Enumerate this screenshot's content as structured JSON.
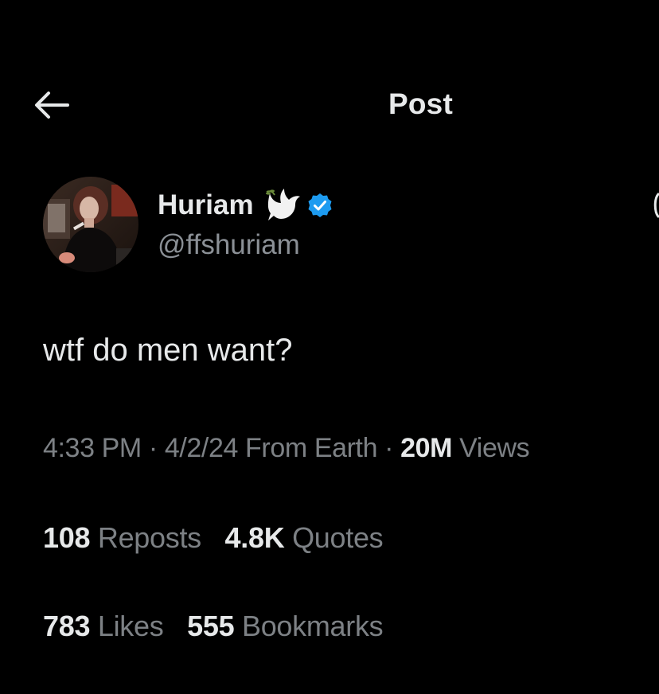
{
  "header": {
    "back_icon": "arrow-left-icon",
    "title": "Post"
  },
  "author": {
    "name": "Huriam",
    "name_emoji_icon": "dove-icon",
    "verified_icon": "verified-badge-icon",
    "verified_color": "#1d9bf0",
    "handle": "@ffshuriam"
  },
  "post": {
    "text": "wtf do men want?",
    "time": "4:33 PM",
    "date": "4/2/24",
    "location": "From Earth",
    "separator": "·",
    "views_count": "20M",
    "views_label": "Views"
  },
  "stats": {
    "reposts_count": "108",
    "reposts_label": "Reposts",
    "quotes_count": "4.8K",
    "quotes_label": "Quotes",
    "likes_count": "783",
    "likes_label": "Likes",
    "bookmarks_count": "555",
    "bookmarks_label": "Bookmarks"
  },
  "colors": {
    "background": "#000000",
    "primary_text": "#e7e9ea",
    "secondary_text": "#7d8185"
  }
}
